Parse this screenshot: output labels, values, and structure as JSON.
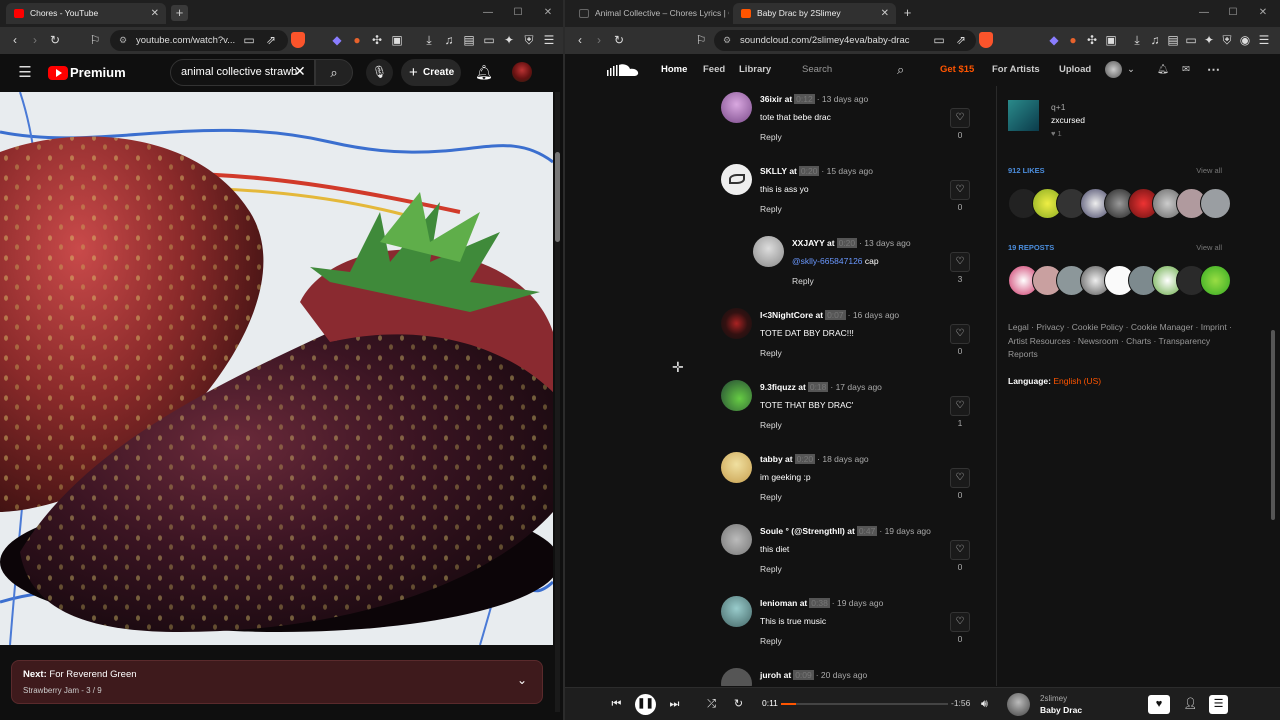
{
  "left_window": {
    "tab_title": "Chores - YouTube",
    "url": "youtube.com/watch?v...",
    "search_query": "animal collective strawb",
    "create_label": "Create",
    "brand": "Premium",
    "next": {
      "label": "Next:",
      "title": "For Reverend Green",
      "playlist": "Strawberry Jam - 3 / 9"
    }
  },
  "right_window": {
    "tabs": [
      {
        "title": "Animal Collective – Chores Lyrics | Ge"
      },
      {
        "title": "Baby Drac by 2Slimey"
      }
    ],
    "url": "soundcloud.com/2slimey4eva/baby-drac",
    "nav": {
      "home": "Home",
      "feed": "Feed",
      "library": "Library",
      "search_placeholder": "Search",
      "get": "Get $15",
      "for_artists": "For Artists",
      "upload": "Upload"
    },
    "comments": [
      {
        "user": "36ixir",
        "at": "at",
        "time_hidden": "0:12",
        "ago": "· 13 days ago",
        "text": "tote that bebe drac",
        "reply": "Reply",
        "likes": "0"
      },
      {
        "user": "SKLLY",
        "at": "at",
        "time_hidden": "0:20",
        "ago": "· 15 days ago",
        "text": "this is ass yo",
        "reply": "Reply",
        "likes": "0"
      },
      {
        "user": "XXJAYY",
        "at": "at",
        "time_hidden": "0:20",
        "ago": "· 13 days ago",
        "mention": "@sklly-665847126",
        "text": " cap",
        "reply": "Reply",
        "likes": "3"
      },
      {
        "user": "I<3NightCore",
        "at": "at",
        "time_hidden": "0:07",
        "ago": "· 16 days ago",
        "text": "TOTE DAT BBY DRAC!!!",
        "reply": "Reply",
        "likes": "0"
      },
      {
        "user": "9.3fiquzz",
        "at": "at",
        "time_hidden": "0:18",
        "ago": "· 17 days ago",
        "text": "TOTE THAT BBY DRAC'",
        "reply": "Reply",
        "likes": "1"
      },
      {
        "user": "tabby",
        "at": "at",
        "time_hidden": "0:20",
        "ago": "· 18 days ago",
        "text": "im geeking :p",
        "reply": "Reply",
        "likes": "0"
      },
      {
        "user": "Soule ° (@Strengthll)",
        "at": "at",
        "time_hidden": "0:47",
        "ago": "· 19 days ago",
        "text": "this diet",
        "reply": "Reply",
        "likes": "0"
      },
      {
        "user": "lenioman",
        "at": "at",
        "time_hidden": "0:38",
        "ago": "· 19 days ago",
        "text": "This is true music",
        "reply": "Reply",
        "likes": "0"
      },
      {
        "user": "juroh",
        "at": "at",
        "time_hidden": "0:09",
        "ago": "· 20 days ago",
        "text": "",
        "reply": "",
        "likes": ""
      }
    ],
    "sidebar": {
      "related": {
        "title": "q+1",
        "artist": "zxcursed",
        "likes": "1"
      },
      "likes_title": "912 LIKES",
      "reposts_title": "19 REPOSTS",
      "view_all": "View all",
      "footer": "Legal · Privacy · Cookie Policy · Cookie Manager · Imprint · Artist Resources · Newsroom · Charts · Transparency Reports",
      "language_label": "Language:",
      "language_value": "English (US)"
    },
    "player": {
      "elapsed": "0:11",
      "remaining": "-1:56",
      "progress_fraction": 0.09,
      "artist": "2slimey",
      "track": "Baby Drac"
    }
  },
  "colors": {
    "soundcloud_orange": "#ff5500",
    "youtube_red": "#ff0000",
    "next_card": "#3e1a1c"
  }
}
